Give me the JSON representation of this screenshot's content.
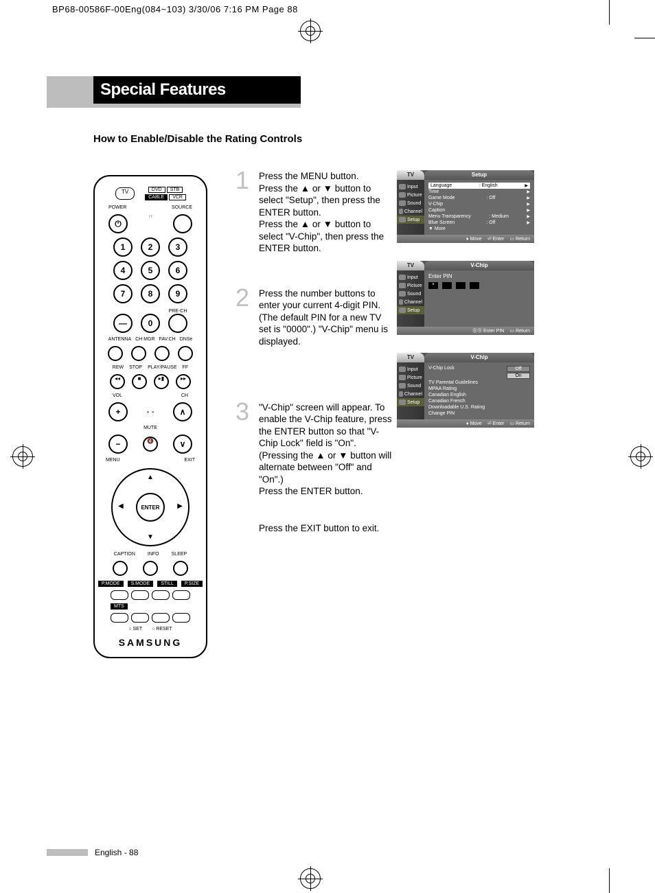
{
  "crop_header": "BP68-00586F-00Eng(084~103)  3/30/06  7:16 PM  Page 88",
  "title": "Special Features",
  "subhead": "How to Enable/Disable the Rating Controls",
  "remote": {
    "tv": "TV",
    "dvd": "DVD",
    "stb": "STB",
    "cable": "CABLE",
    "vcr": "VCR",
    "power": "POWER",
    "source": "SOURCE",
    "nums": [
      "1",
      "2",
      "3",
      "4",
      "5",
      "6",
      "7",
      "8",
      "9",
      "0"
    ],
    "dash": "—",
    "prech": "PRE-CH",
    "antenna": "ANTENNA",
    "chmgr": "CH MGR",
    "favch": "FAV.CH",
    "dnse": "DNSe",
    "rew": "REW",
    "stop": "STOP",
    "playpause": "PLAY/PAUSE",
    "ff": "FF",
    "vol": "VOL",
    "ch": "CH",
    "mute": "MUTE",
    "menu": "MENU",
    "exit": "EXIT",
    "enter": "ENTER",
    "caption": "CAPTION",
    "info": "INFO",
    "sleep": "SLEEP",
    "pmode": "P.MODE",
    "smode": "S.MODE",
    "still": "STILL",
    "psize": "P.SIZE",
    "mts": "MTS",
    "set": "SET",
    "reset": "RESET",
    "brand": "SAMSUNG"
  },
  "steps": [
    {
      "num": "1",
      "text": "Press the MENU button.\nPress the ▲ or ▼ button to select \"Setup\", then press the ENTER button.\nPress the ▲ or ▼ button to select \"V-Chip\", then press the ENTER button."
    },
    {
      "num": "2",
      "text": "Press the number buttons to enter your current 4-digit PIN. (The default PIN for a new TV set is \"0000\".) \"V-Chip\" menu is displayed."
    },
    {
      "num": "3",
      "text": "\"V-Chip\" screen will appear. To enable the V-Chip feature, press the ENTER button so that \"V-Chip Lock\" field is \"On\". (Pressing the ▲ or ▼ button will alternate between \"Off\" and \"On\".)\nPress the ENTER button."
    }
  ],
  "exit_note": "Press the EXIT button to exit.",
  "osd_tv": "TV",
  "osd_side": [
    "Input",
    "Picture",
    "Sound",
    "Channel",
    "Setup"
  ],
  "osd1": {
    "title": "Setup",
    "rows": [
      {
        "k": "Language",
        "v": ": English",
        "sel": true
      },
      {
        "k": "Time",
        "v": ""
      },
      {
        "k": "Game Mode",
        "v": ": Off"
      },
      {
        "k": "V-Chip",
        "v": ""
      },
      {
        "k": "Caption",
        "v": ""
      },
      {
        "k": "Menu Transparency",
        "v": ": Medium"
      },
      {
        "k": "Blue Screen",
        "v": ": Off"
      },
      {
        "k": "▼ More",
        "v": ""
      }
    ],
    "foot": [
      "Move",
      "Enter",
      "Return"
    ]
  },
  "osd2": {
    "title": "V-Chip",
    "enter_pin": "Enter PIN",
    "foot": [
      "Enter PIN",
      "Return"
    ]
  },
  "osd3": {
    "title": "V-Chip",
    "rows": [
      {
        "k": "V-Chip Lock",
        "opts": [
          "Off",
          "On"
        ]
      },
      {
        "k": "TV Parental Guidelines"
      },
      {
        "k": "MPAA Rating"
      },
      {
        "k": "Canadian English"
      },
      {
        "k": "Canadian French"
      },
      {
        "k": "Downloadable U.S. Rating"
      },
      {
        "k": "Change PIN"
      }
    ],
    "foot": [
      "Move",
      "Enter",
      "Return"
    ]
  },
  "footer": "English - 88"
}
